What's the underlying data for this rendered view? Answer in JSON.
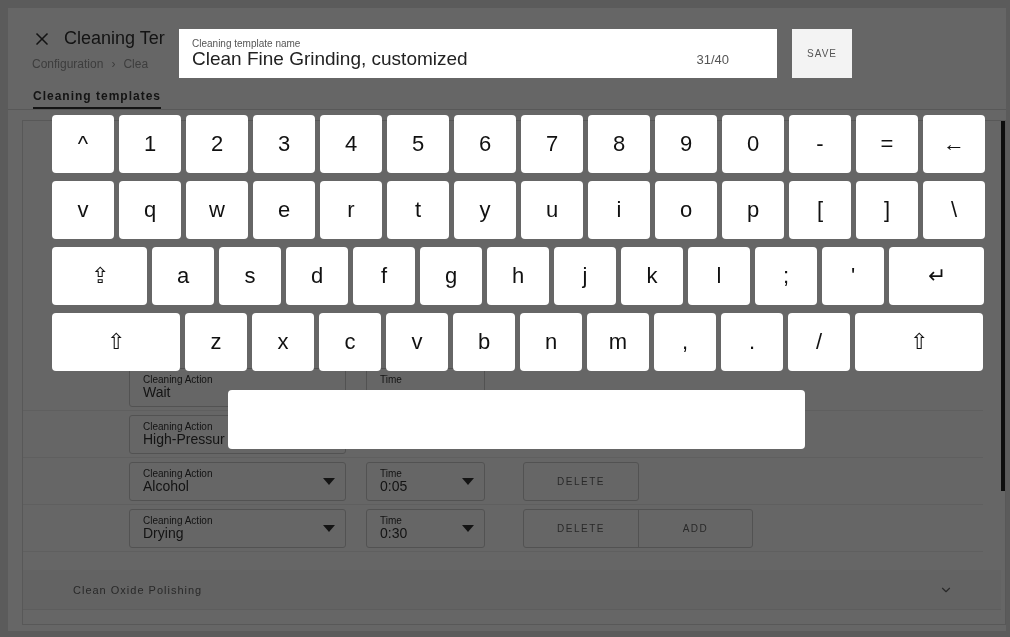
{
  "header": {
    "title": "Cleaning Ter",
    "breadcrumb": [
      "Configuration",
      "Clea"
    ],
    "breadcrumb_separator": "›"
  },
  "tabs": [
    {
      "label": "Cleaning templates",
      "selected": true
    }
  ],
  "steps": [
    {
      "action_label": "Cleaning Action",
      "action": "Wait",
      "time_label": "Time"
    },
    {
      "action_label": "Cleaning Action",
      "action": "High-Pressur"
    },
    {
      "action_label": "Cleaning Action",
      "action": "Alcohol",
      "time_label": "Time",
      "time": "0:05",
      "buttons": [
        "DELETE"
      ]
    },
    {
      "action_label": "Cleaning Action",
      "action": "Drying",
      "time_label": "Time",
      "time": "0:30",
      "buttons": [
        "DELETE",
        "ADD"
      ]
    }
  ],
  "sections": [
    {
      "title": "Clean Oxide Polishing",
      "expanded": false
    }
  ],
  "editor": {
    "label": "Cleaning template name",
    "value": "Clean Fine Grinding, customized",
    "counter": "31/40",
    "save_button": "SAVE"
  },
  "keyboard": {
    "rows": [
      {
        "keys": [
          {
            "label": "^",
            "kind": "key"
          },
          {
            "label": "1",
            "kind": "key"
          },
          {
            "label": "2",
            "kind": "key"
          },
          {
            "label": "3",
            "kind": "key"
          },
          {
            "label": "4",
            "kind": "key"
          },
          {
            "label": "5",
            "kind": "key"
          },
          {
            "label": "6",
            "kind": "key"
          },
          {
            "label": "7",
            "kind": "key"
          },
          {
            "label": "8",
            "kind": "key"
          },
          {
            "label": "9",
            "kind": "key"
          },
          {
            "label": "0",
            "kind": "key"
          },
          {
            "label": "-",
            "kind": "key"
          },
          {
            "label": "=",
            "kind": "key"
          },
          {
            "label": "←",
            "kind": "key"
          }
        ]
      },
      {
        "keys": [
          {
            "label": "v",
            "kind": "key"
          },
          {
            "label": "q",
            "kind": "key"
          },
          {
            "label": "w",
            "kind": "key"
          },
          {
            "label": "e",
            "kind": "key"
          },
          {
            "label": "r",
            "kind": "key"
          },
          {
            "label": "t",
            "kind": "key"
          },
          {
            "label": "y",
            "kind": "key"
          },
          {
            "label": "u",
            "kind": "key"
          },
          {
            "label": "i",
            "kind": "key"
          },
          {
            "label": "o",
            "kind": "key"
          },
          {
            "label": "p",
            "kind": "key"
          },
          {
            "label": "[",
            "kind": "key"
          },
          {
            "label": "]",
            "kind": "key"
          },
          {
            "label": "\\",
            "kind": "key"
          }
        ]
      },
      {
        "keys": [
          {
            "label": "⇪",
            "kind": "wide"
          },
          {
            "label": "a",
            "kind": "key"
          },
          {
            "label": "s",
            "kind": "key"
          },
          {
            "label": "d",
            "kind": "key"
          },
          {
            "label": "f",
            "kind": "key"
          },
          {
            "label": "g",
            "kind": "key"
          },
          {
            "label": "h",
            "kind": "key"
          },
          {
            "label": "j",
            "kind": "key"
          },
          {
            "label": "k",
            "kind": "key"
          },
          {
            "label": "l",
            "kind": "key"
          },
          {
            "label": ";",
            "kind": "key"
          },
          {
            "label": "'",
            "kind": "key"
          },
          {
            "label": "↵",
            "kind": "wide"
          }
        ]
      },
      {
        "keys": [
          {
            "label": "⇧",
            "kind": "wider"
          },
          {
            "label": "z",
            "kind": "key"
          },
          {
            "label": "x",
            "kind": "key"
          },
          {
            "label": "c",
            "kind": "key"
          },
          {
            "label": "v",
            "kind": "key"
          },
          {
            "label": "b",
            "kind": "key"
          },
          {
            "label": "n",
            "kind": "key"
          },
          {
            "label": "m",
            "kind": "key"
          },
          {
            "label": ",",
            "kind": "key"
          },
          {
            "label": ".",
            "kind": "key"
          },
          {
            "label": "/",
            "kind": "key"
          },
          {
            "label": "⇧",
            "kind": "wider"
          }
        ]
      }
    ]
  }
}
